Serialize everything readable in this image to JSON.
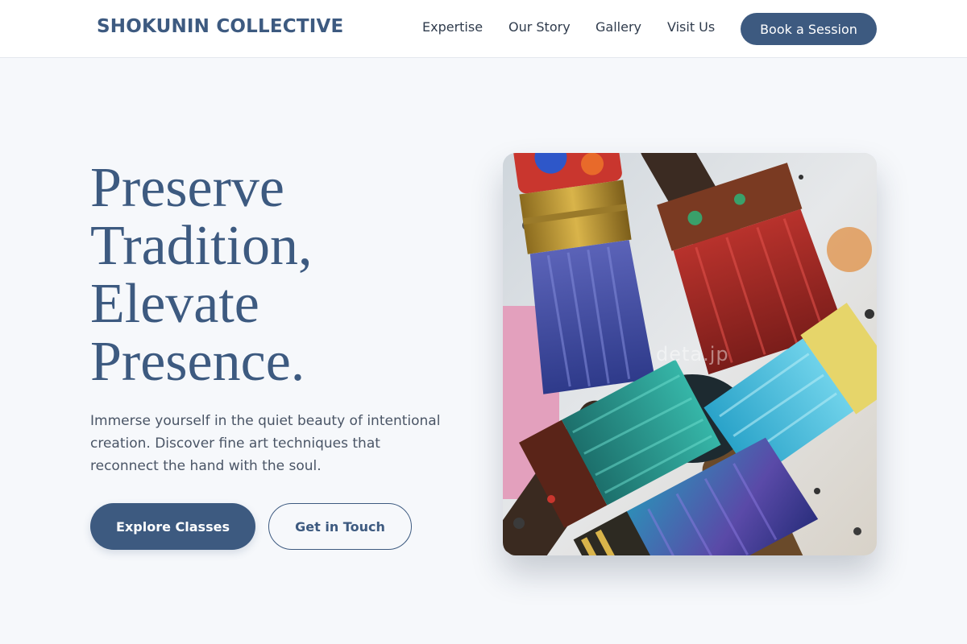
{
  "header": {
    "brand": "SHOKUNIN COLLECTIVE",
    "nav": [
      "Expertise",
      "Our Story",
      "Gallery",
      "Visit Us"
    ],
    "cta_label": "Book a Session"
  },
  "hero": {
    "headline_lines": [
      "Preserve",
      "Tradition,",
      "Elevate",
      "Presence."
    ],
    "lede": "Immerse yourself in the quiet beauty of intentional creation. Discover fine art techniques that reconnect the hand with the soul.",
    "primary_button": "Explore Classes",
    "secondary_button": "Get in Touch",
    "image": {
      "subject": "paint-brushes-photo",
      "watermark": "deta.jp"
    }
  },
  "colors": {
    "accent": "#3d5a80",
    "page_background": "#f6f8fb",
    "header_background": "#ffffff",
    "body_text": "#4a5566"
  }
}
